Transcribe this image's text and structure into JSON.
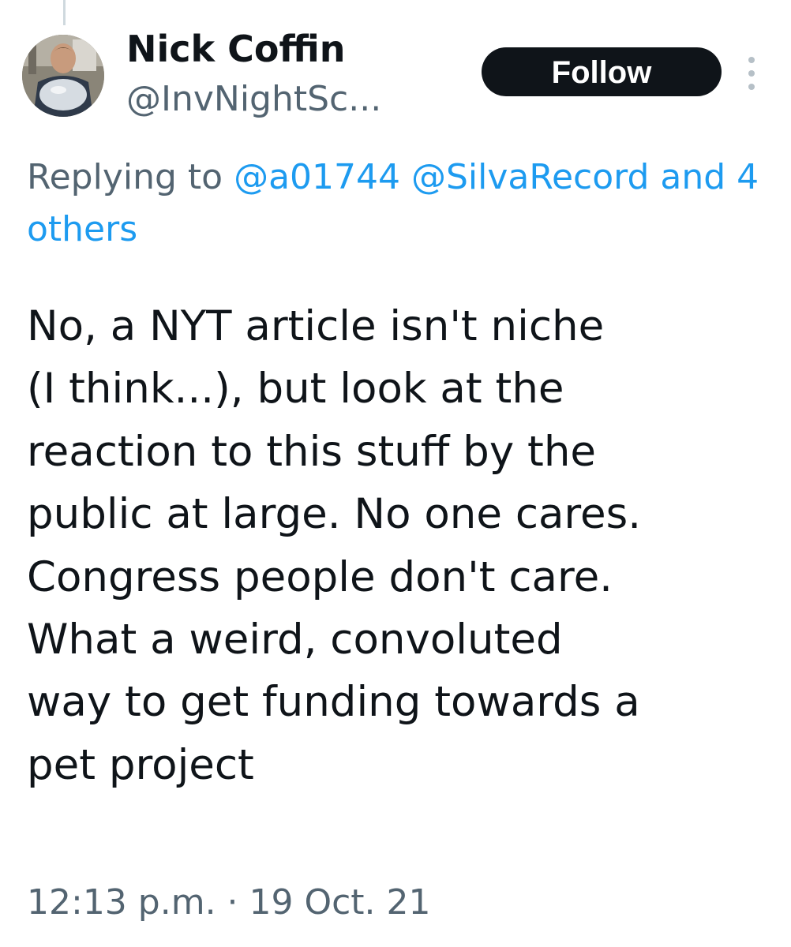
{
  "tweet": {
    "author": {
      "display_name": "Nick Coffin",
      "handle": "@InvNightSc..."
    },
    "follow_label": "Follow",
    "replying_prefix": "Replying to",
    "replying_users": [
      "@a01744",
      "@SilvaRecord"
    ],
    "replying_others": "and 4 others",
    "body_lines": [
      "No, a NYT article isn't niche",
      "(I think...), but look at the",
      "reaction to this stuff by the",
      "public at large. No one cares.",
      "Congress people don't care.",
      "What a weird, convoluted",
      "way to get funding towards a",
      "pet project"
    ],
    "timestamp": "12:13 p.m. · 19 Oct. 21"
  },
  "icons": {
    "more": "more-vertical-icon"
  },
  "colors": {
    "text": "#0f1419",
    "secondary": "#536471",
    "link": "#1d9bf0",
    "button_bg": "#0f1419",
    "button_text": "#ffffff"
  }
}
